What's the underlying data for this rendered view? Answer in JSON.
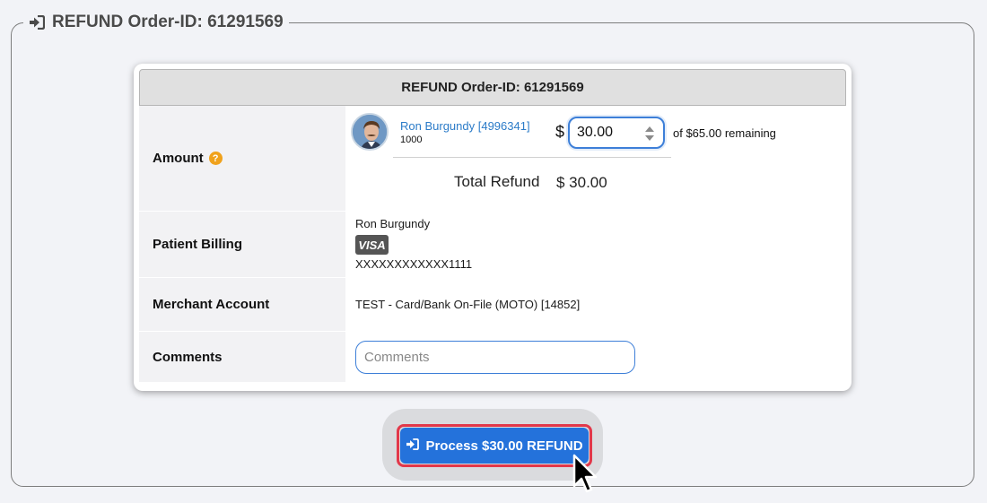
{
  "legend": {
    "icon": "sign-in-icon",
    "title": "REFUND Order-ID: 61291569"
  },
  "card": {
    "header": "REFUND Order-ID: 61291569",
    "rows": {
      "amount": {
        "label": "Amount",
        "help_icon": "?",
        "patient_link": "Ron Burgundy [4996341]",
        "patient_number": "1000",
        "currency": "$",
        "input_value": "30.00",
        "remaining_text": "of  $65.00 remaining",
        "total_label": "Total Refund",
        "total_value": "$ 30.00"
      },
      "billing": {
        "label": "Patient Billing",
        "name": "Ron Burgundy",
        "card_brand": "VISA",
        "card_number": "XXXXXXXXXXXX1111"
      },
      "merchant": {
        "label": "Merchant Account",
        "value": "TEST - Card/Bank On-File (MOTO) [14852]"
      },
      "comments": {
        "label": "Comments",
        "placeholder": "Comments"
      }
    }
  },
  "process_button": {
    "label": "Process $30.00 REFUND",
    "icon": "sign-in-icon"
  },
  "colors": {
    "accent": "#2472db",
    "highlight": "#e2384a",
    "link": "#2b7bc8",
    "help": "#f0a21c"
  }
}
